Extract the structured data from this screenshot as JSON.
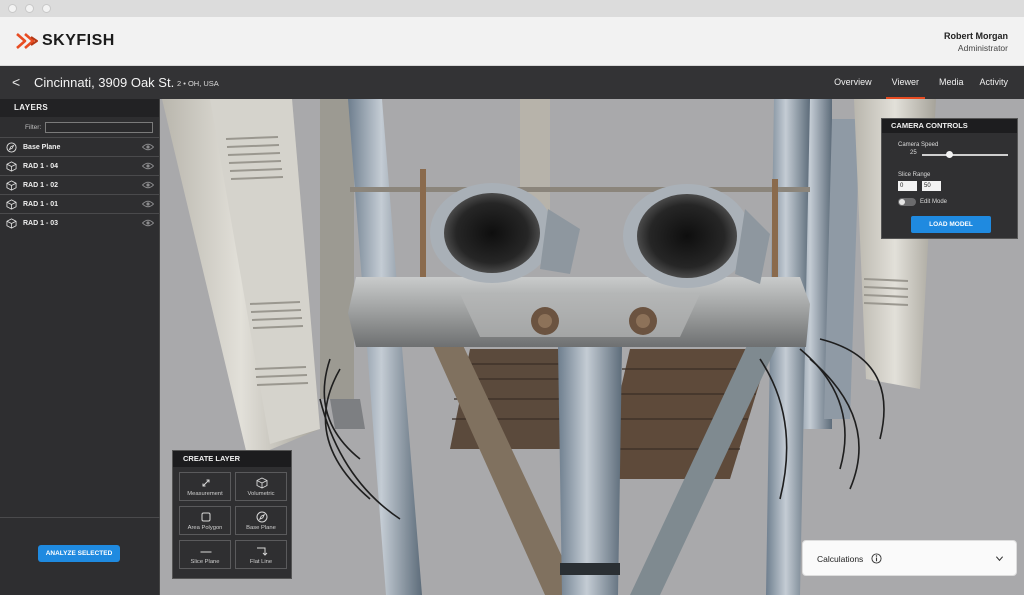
{
  "brand": {
    "name": "SKYFISH",
    "accent": "#e84c22",
    "primary_blue": "#1f8ae0"
  },
  "user": {
    "name": "Robert Morgan",
    "role": "Administrator"
  },
  "location": {
    "back_icon": "chevron-left-icon",
    "back": "<",
    "title": "Cincinnati, 3909 Oak St.",
    "subtitle": "2 • OH, USA"
  },
  "tabs": [
    {
      "label": "Overview",
      "active": false
    },
    {
      "label": "Viewer",
      "active": true
    },
    {
      "label": "Media",
      "active": false
    },
    {
      "label": "Activity",
      "active": false
    }
  ],
  "layers_panel": {
    "title": "LAYERS",
    "filter_label": "Filter:",
    "filter_value": "",
    "items": [
      {
        "label": "Base Plane",
        "icon": "compass-icon"
      },
      {
        "label": "RAD 1 - 04",
        "icon": "cube-icon"
      },
      {
        "label": "RAD 1 - 02",
        "icon": "cube-icon"
      },
      {
        "label": "RAD 1 - 01",
        "icon": "cube-icon"
      },
      {
        "label": "RAD 1 - 03",
        "icon": "cube-icon"
      }
    ],
    "analyze_button": "ANALYZE SELECTED"
  },
  "camera_controls": {
    "title": "CAMERA CONTROLS",
    "speed_label": "Camera Speed",
    "speed_value": "25",
    "slice_label": "Slice Range",
    "slice_min": "0",
    "slice_max": "50",
    "edit_mode_label": "Edit Mode",
    "load_button": "LOAD MODEL"
  },
  "create_layer": {
    "title": "CREATE LAYER",
    "tools": [
      {
        "label": "Measurement",
        "icon": "arrows-expand-icon"
      },
      {
        "label": "Volumetric",
        "icon": "cube-icon"
      },
      {
        "label": "Area Polygon",
        "icon": "square-icon"
      },
      {
        "label": "Base Plane",
        "icon": "compass-icon"
      },
      {
        "label": "Slice Plane",
        "icon": "line-icon"
      },
      {
        "label": "Flat Line",
        "icon": "corner-arrow-icon"
      }
    ]
  },
  "calculations": {
    "label": "Calculations"
  }
}
